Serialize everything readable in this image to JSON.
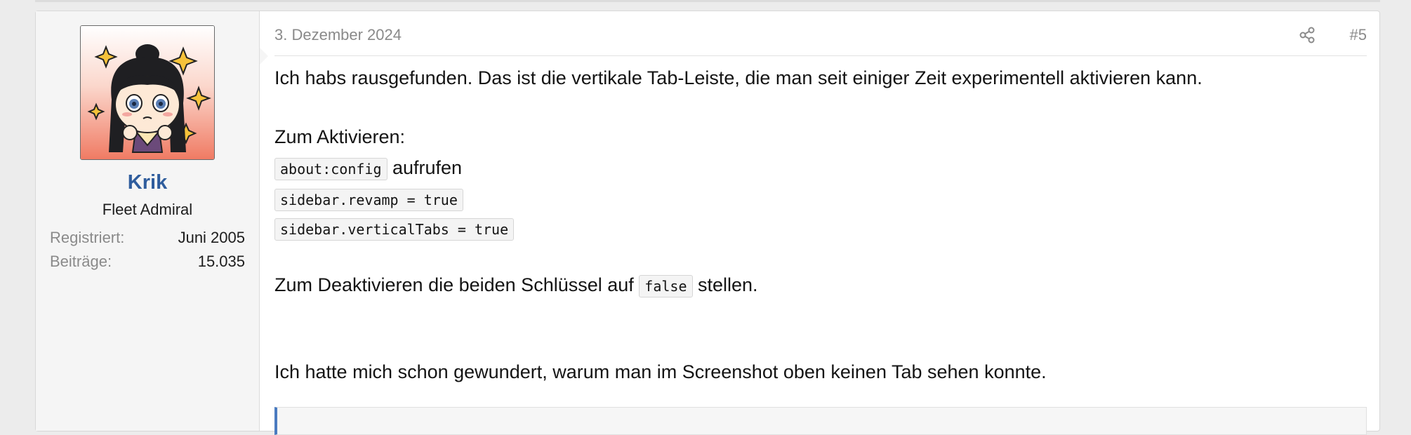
{
  "user": {
    "name": "Krik",
    "title": "Fleet Admiral",
    "stats": [
      {
        "label": "Registriert:",
        "value": "Juni 2005"
      },
      {
        "label": "Beiträge:",
        "value": "15.035"
      }
    ]
  },
  "post": {
    "date": "3. Dezember 2024",
    "number": "#5",
    "share_icon": "share-icon",
    "line1": "Ich habs rausgefunden. Das ist die vertikale Tab-Leiste, die man seit einiger Zeit experimentell aktivieren kann.",
    "activate_heading": "Zum Aktivieren:",
    "code1": "about:config",
    "code1_suffix": " aufrufen",
    "code2": "sidebar.revamp = true",
    "code3": "sidebar.verticalTabs = true",
    "deactivate_prefix": "Zum Deaktivieren die beiden Schlüssel auf ",
    "deactivate_code": "false",
    "deactivate_suffix": " stellen.",
    "line_last": "Ich hatte mich schon gewundert, warum man im Screenshot oben keinen Tab sehen konnte."
  }
}
